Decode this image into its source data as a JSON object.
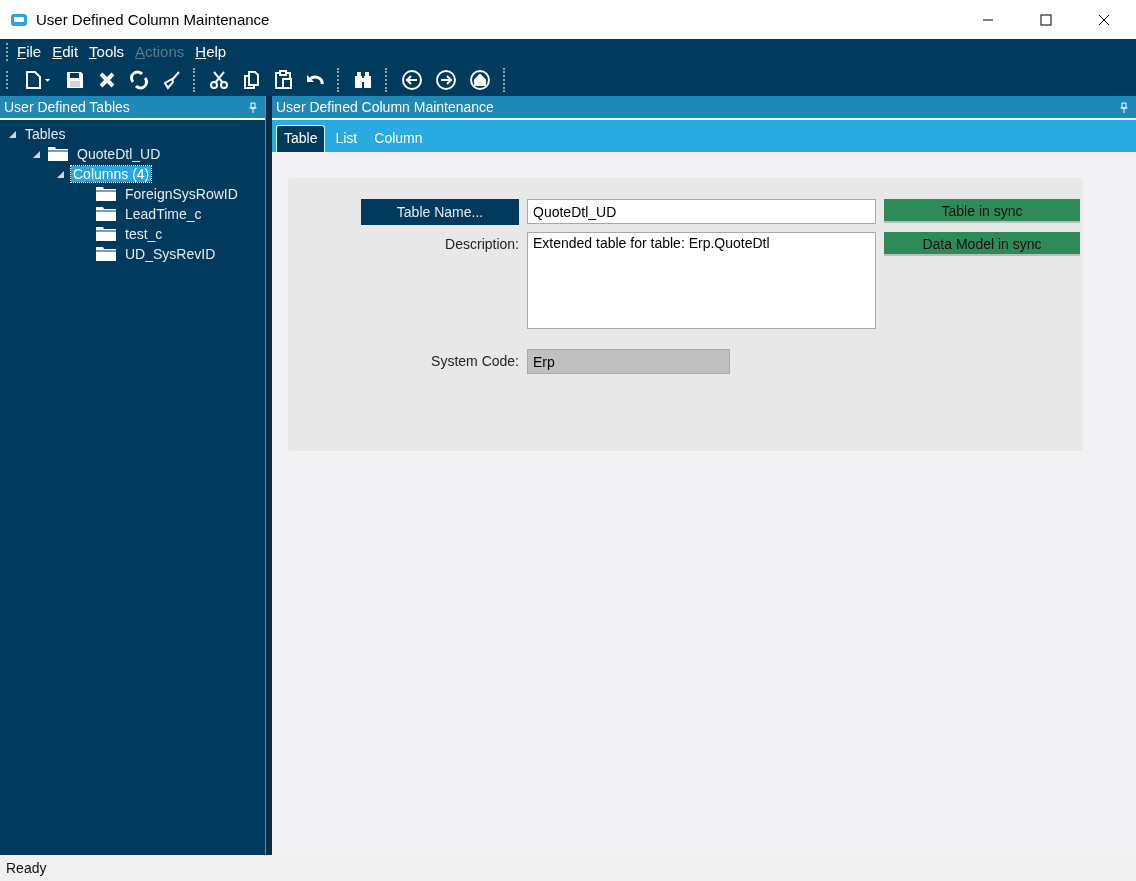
{
  "window": {
    "title": "User Defined Column Maintenance"
  },
  "menu": [
    {
      "label": "File",
      "disabled": false
    },
    {
      "label": "Edit",
      "disabled": false
    },
    {
      "label": "Tools",
      "disabled": false
    },
    {
      "label": "Actions",
      "disabled": true
    },
    {
      "label": "Help",
      "disabled": false
    }
  ],
  "toolbar": [
    {
      "kind": "new"
    },
    {
      "kind": "save"
    },
    {
      "kind": "delete"
    },
    {
      "kind": "refresh"
    },
    {
      "kind": "clear"
    },
    {
      "kind": "sep"
    },
    {
      "kind": "cut"
    },
    {
      "kind": "copy"
    },
    {
      "kind": "paste"
    },
    {
      "kind": "undo"
    },
    {
      "kind": "sep"
    },
    {
      "kind": "search"
    },
    {
      "kind": "sep"
    },
    {
      "kind": "back"
    },
    {
      "kind": "forward"
    },
    {
      "kind": "home"
    },
    {
      "kind": "sep"
    }
  ],
  "left_panel": {
    "title": "User Defined Tables",
    "tree": [
      {
        "label": "Tables",
        "folder": false,
        "expanded": true,
        "selected": false,
        "children": [
          {
            "label": "QuoteDtl_UD",
            "folder": true,
            "expanded": true,
            "selected": false,
            "children": [
              {
                "label": "Columns (4)",
                "folder": false,
                "expanded": true,
                "selected": true,
                "children": [
                  {
                    "label": "ForeignSysRowID",
                    "folder": true,
                    "expanded": false,
                    "selected": false
                  },
                  {
                    "label": "LeadTime_c",
                    "folder": true,
                    "expanded": false,
                    "selected": false
                  },
                  {
                    "label": "test_c",
                    "folder": true,
                    "expanded": false,
                    "selected": false
                  },
                  {
                    "label": "UD_SysRevID",
                    "folder": true,
                    "expanded": false,
                    "selected": false
                  }
                ]
              }
            ]
          }
        ]
      }
    ]
  },
  "right_panel": {
    "title": "User Defined Column Maintenance",
    "tabs": [
      {
        "label": "Table",
        "selected": true
      },
      {
        "label": "List",
        "selected": false
      },
      {
        "label": "Column",
        "selected": false
      }
    ],
    "form": {
      "table_name_button": "Table Name...",
      "table_name": "QuoteDtl_UD",
      "description_label": "Description:",
      "description": "Extended table for table: Erp.QuoteDtl",
      "system_code_label": "System Code:",
      "system_code": "Erp",
      "status": [
        {
          "label": "Table in sync",
          "color": "#2e8b57"
        },
        {
          "label": "Data Model in sync",
          "color": "#2e8b57"
        }
      ]
    }
  },
  "status_bar": "Ready"
}
